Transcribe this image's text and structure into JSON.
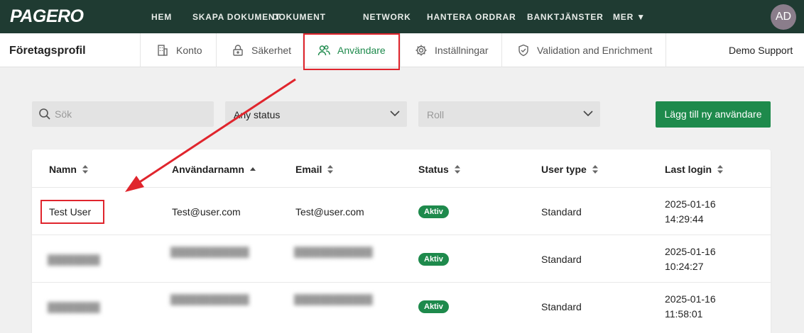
{
  "topbar": {
    "logo": "PAGERO",
    "nav": [
      "HEM",
      "SKAPA DOKUMENT",
      "DOKUMENT",
      "NETWORK",
      "HANTERA ORDRAR",
      "BANKTJÄNSTER",
      "MER ▼"
    ],
    "avatar": "AD"
  },
  "subnav": {
    "company": "Företagsprofil",
    "tabs": [
      "Konto",
      "Säkerhet",
      "Användare",
      "Inställningar",
      "Validation and Enrichment"
    ],
    "active_tab": "Användare",
    "user": "Demo Support"
  },
  "filters": {
    "search_placeholder": "Sök",
    "status_value": "Any status",
    "role_placeholder": "Roll",
    "add_button": "Lägg till ny användare"
  },
  "table": {
    "columns": [
      "Namn",
      "Användarnamn",
      "Email",
      "Status",
      "User type",
      "Last login"
    ],
    "rows": [
      {
        "name": "Test User",
        "username": "Test@user.com",
        "email": "Test@user.com",
        "status": "Aktiv",
        "user_type": "Standard",
        "last_login_date": "2025-01-16",
        "last_login_time": "14:29:44"
      },
      {
        "name": "████████",
        "username": "████████████",
        "email": "████████████",
        "status": "Aktiv",
        "user_type": "Standard",
        "last_login_date": "2025-01-16",
        "last_login_time": "10:24:27"
      },
      {
        "name": "████████",
        "username": "████████████",
        "email": "████████████",
        "status": "Aktiv",
        "user_type": "Standard",
        "last_login_date": "2025-01-16",
        "last_login_time": "11:58:01"
      }
    ]
  },
  "colors": {
    "topbar": "#1f3b32",
    "accent": "#1e8a4c",
    "highlight": "#e0252d"
  }
}
